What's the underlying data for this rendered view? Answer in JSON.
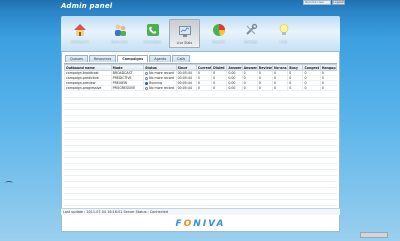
{
  "app": {
    "title": "Admin panel"
  },
  "header": {
    "field_placeholder": "Remote User",
    "button_label": "Logout"
  },
  "toolbar": {
    "items": [
      {
        "label": "Dashboard",
        "icon": "house-icon"
      },
      {
        "label": "Resources",
        "icon": "users-icon"
      },
      {
        "label": "Campaigns",
        "icon": "phone-icon"
      },
      {
        "label": "Live Stats",
        "icon": "monitor-icon",
        "active": true
      },
      {
        "label": "Reports",
        "icon": "pie-chart-icon"
      },
      {
        "label": "Settings",
        "icon": "wrench-icon"
      },
      {
        "label": "Help",
        "icon": "lightbulb-icon"
      }
    ]
  },
  "tabs": [
    "Queues",
    "Resources",
    "Campaigns",
    "Agents",
    "Calls"
  ],
  "active_tab": "Campaigns",
  "table": {
    "headers": [
      "Outbound name",
      "Mode",
      "Status",
      "Since",
      "Current",
      "Dialed",
      "Answer",
      "Answer.",
      "Reviewe",
      "No-ans",
      "Busy",
      "Congest",
      "Hangup"
    ],
    "rows": [
      {
        "name": "campaign-broadcast",
        "mode": "BROADCAST",
        "status": "No more record",
        "status_on": false,
        "since": "00:05:44",
        "current": "0",
        "dialed": "0",
        "answer": "0.00",
        "answer2": "0",
        "reviewe": "0",
        "noans": "0",
        "busy": "0",
        "congest": "0",
        "hangup": "0"
      },
      {
        "name": "campaign-predictive",
        "mode": "PREDICTIVE",
        "status": "No more record",
        "status_on": false,
        "since": "00:05:44",
        "current": "0",
        "dialed": "0",
        "answer": "0.00",
        "answer2": "0",
        "reviewe": "0",
        "noans": "0",
        "busy": "0",
        "congest": "0",
        "hangup": "0"
      },
      {
        "name": "campaign-preview",
        "mode": "PREVIEW",
        "status": "Running",
        "status_on": true,
        "since": "00:05:44",
        "current": "0",
        "dialed": "0",
        "answer": "0.00",
        "answer2": "0",
        "reviewe": "0",
        "noans": "0",
        "busy": "0",
        "congest": "0",
        "hangup": "0"
      },
      {
        "name": "campaign-progressive",
        "mode": "PROGRESSIVE",
        "status": "No more record",
        "status_on": false,
        "since": "00:05:44",
        "current": "0",
        "dialed": "0",
        "answer": "0.00",
        "answer2": "0",
        "reviewe": "0",
        "noans": "0",
        "busy": "0",
        "congest": "0",
        "hangup": "0"
      }
    ]
  },
  "status_bar": "Last update : 2011-07-04 16:16:01  Server Status : Connected",
  "logo": {
    "part1": "F",
    "part2": "O",
    "part3": "NIVA"
  }
}
